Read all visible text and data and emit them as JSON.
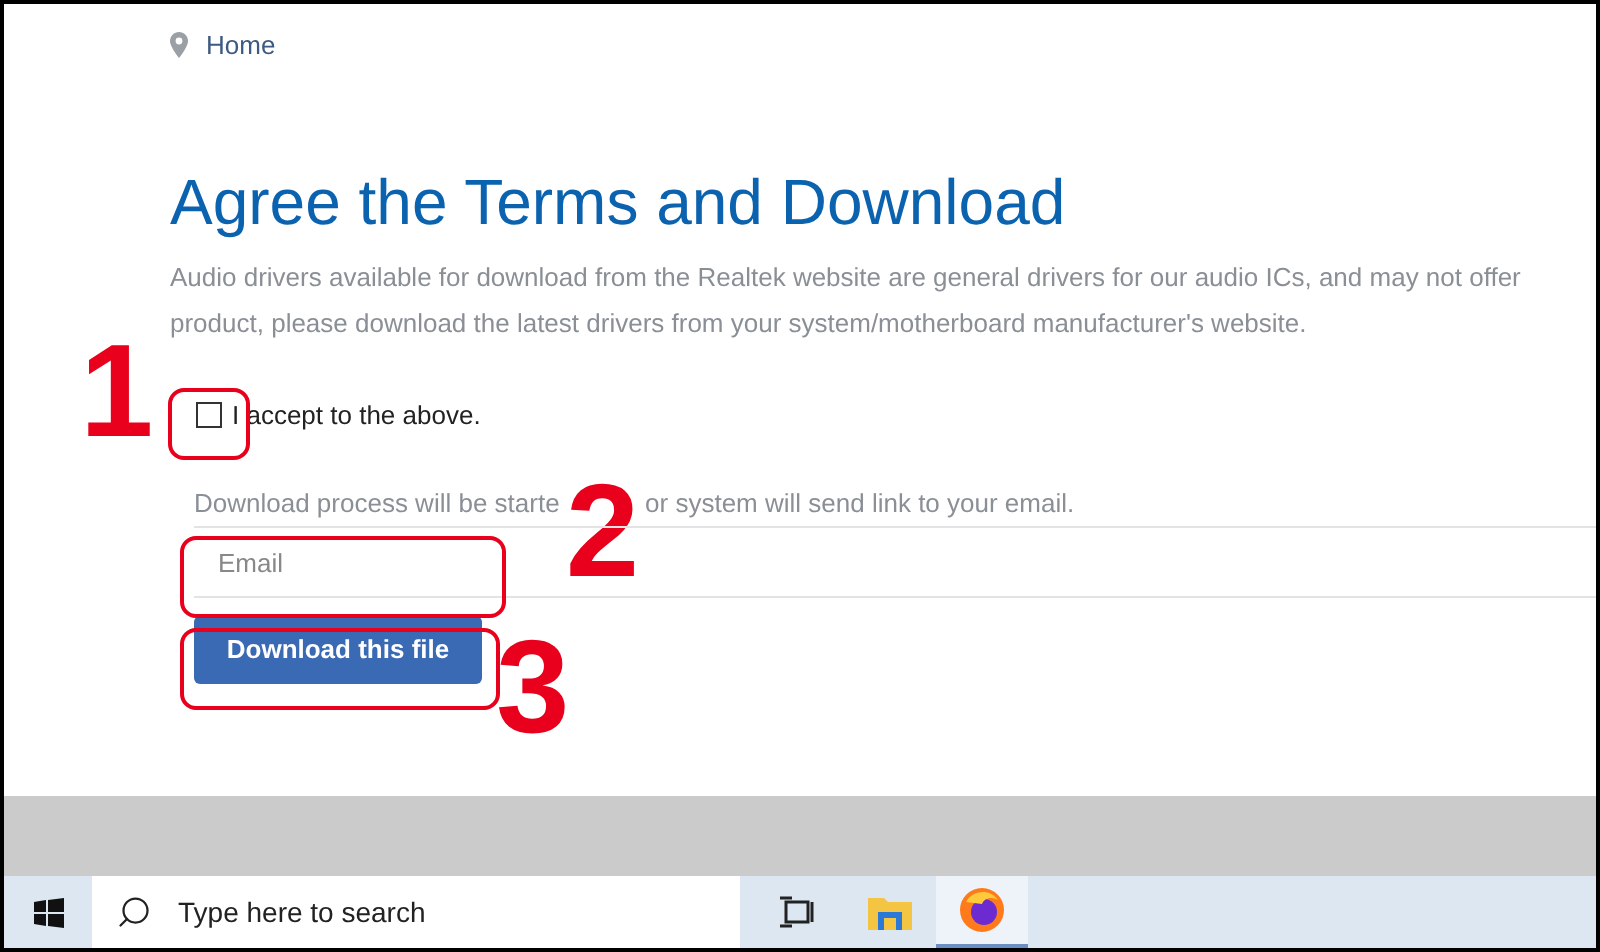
{
  "breadcrumb": {
    "label": "Home"
  },
  "heading": "Agree the Terms and Download",
  "description": [
    "Audio drivers available for download from the Realtek website are general drivers for our audio ICs, and may not offer",
    "product, please download the latest drivers from your system/motherboard manufacturer's website."
  ],
  "agreement": {
    "label": "I accept to the above.",
    "checked": false
  },
  "hint": [
    "Download process will be starte",
    "or system will send link to your email."
  ],
  "email": {
    "placeholder": "Email"
  },
  "download_button": "Download this file",
  "annotations": [
    {
      "number": "1",
      "kind": "checkbox"
    },
    {
      "number": "2",
      "kind": "email"
    },
    {
      "number": "3",
      "kind": "button"
    }
  ],
  "taskbar": {
    "search": {
      "placeholder": "Type here to search"
    },
    "apps": [
      {
        "kind": "taskview",
        "selected": false
      },
      {
        "kind": "explorer",
        "selected": false
      },
      {
        "kind": "firefox",
        "selected": true
      }
    ]
  }
}
